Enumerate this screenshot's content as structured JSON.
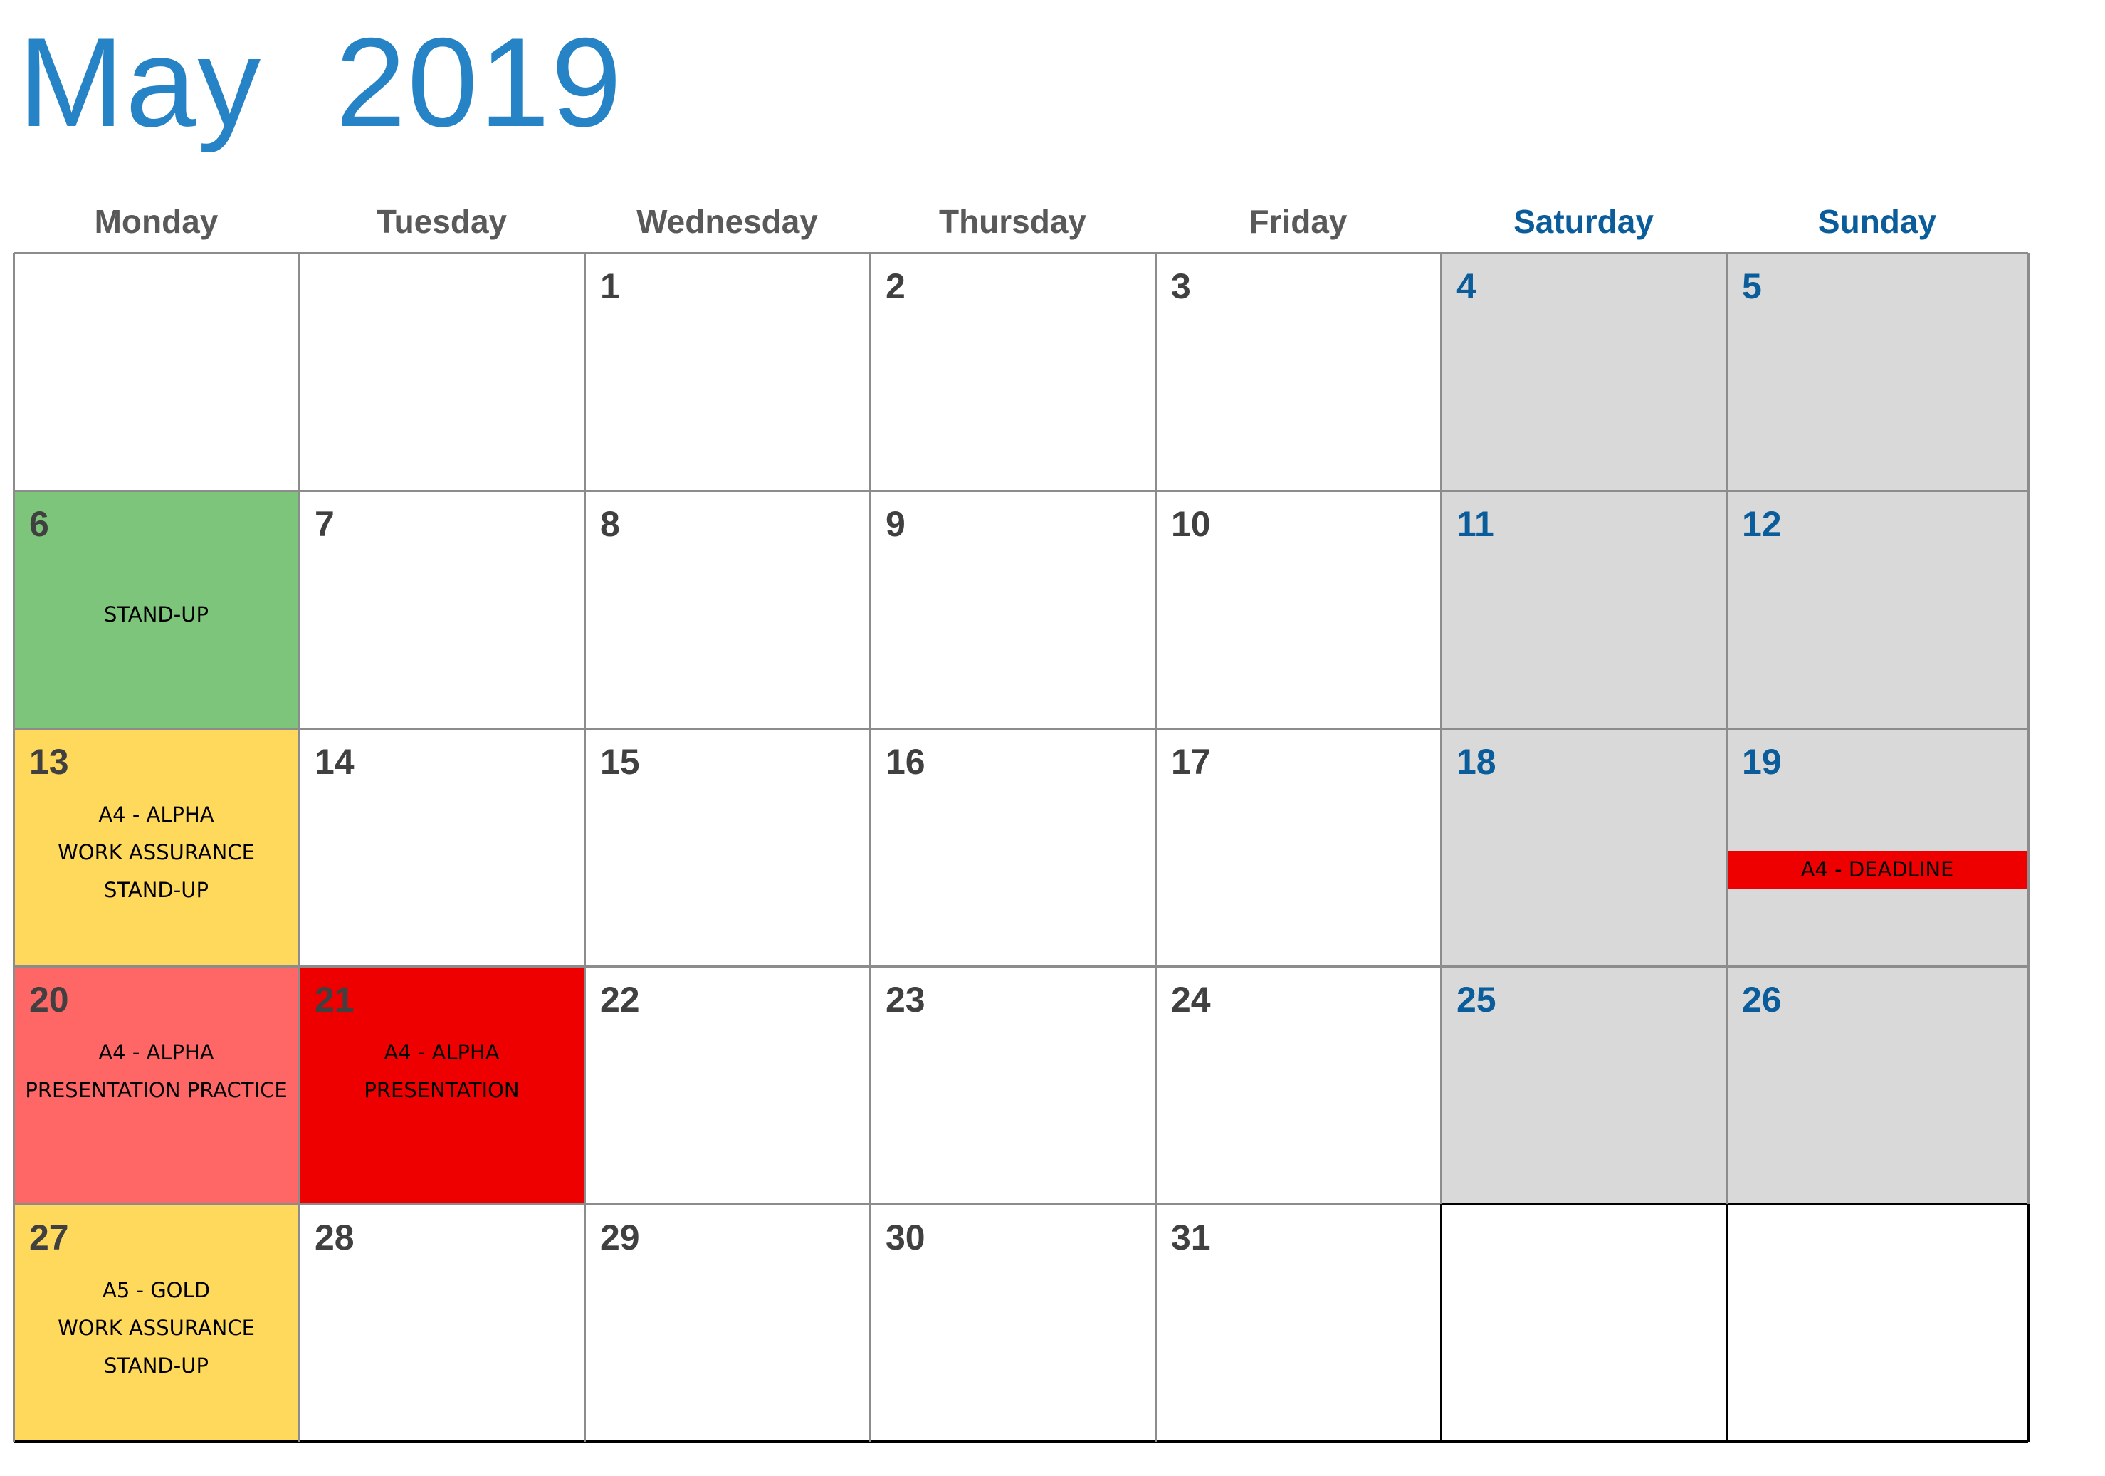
{
  "calendar": {
    "month": "May",
    "year": "2019",
    "weekdays": [
      "Monday",
      "Tuesday",
      "Wednesday",
      "Thursday",
      "Friday",
      "Saturday",
      "Sunday"
    ],
    "colors": {
      "title": "#2683c6",
      "weekday_text": "#595959",
      "weekend_text": "#0a5d9a",
      "weekend_bg": "#d9d9d9",
      "green": "#7dc57a",
      "yellow": "#ffd95c",
      "salmon": "#ff6666",
      "red": "#ee0000",
      "gridline": "#8c8c8c",
      "outline": "#000000"
    },
    "weeks": [
      [
        {
          "day": "",
          "bg": "white",
          "events": []
        },
        {
          "day": "",
          "bg": "white",
          "events": []
        },
        {
          "day": "1",
          "bg": "white",
          "events": []
        },
        {
          "day": "2",
          "bg": "white",
          "events": []
        },
        {
          "day": "3",
          "bg": "white",
          "events": []
        },
        {
          "day": "4",
          "bg": "weekend",
          "events": []
        },
        {
          "day": "5",
          "bg": "weekend",
          "events": []
        }
      ],
      [
        {
          "day": "6",
          "bg": "green",
          "events": [
            "",
            "STAND-UP"
          ]
        },
        {
          "day": "7",
          "bg": "white",
          "events": []
        },
        {
          "day": "8",
          "bg": "white",
          "events": []
        },
        {
          "day": "9",
          "bg": "white",
          "events": []
        },
        {
          "day": "10",
          "bg": "white",
          "events": []
        },
        {
          "day": "11",
          "bg": "weekend",
          "events": []
        },
        {
          "day": "12",
          "bg": "weekend",
          "events": []
        }
      ],
      [
        {
          "day": "13",
          "bg": "yellow",
          "events": [
            "A4 - ALPHA",
            "WORK ASSURANCE",
            "STAND-UP"
          ]
        },
        {
          "day": "14",
          "bg": "white",
          "events": []
        },
        {
          "day": "15",
          "bg": "white",
          "events": []
        },
        {
          "day": "16",
          "bg": "white",
          "events": []
        },
        {
          "day": "17",
          "bg": "white",
          "events": []
        },
        {
          "day": "18",
          "bg": "weekend",
          "events": []
        },
        {
          "day": "19",
          "bg": "weekend",
          "events": [],
          "banner": "A4 - DEADLINE"
        }
      ],
      [
        {
          "day": "20",
          "bg": "salmon",
          "events": [
            "A4 - ALPHA",
            "PRESENTATION PRACTICE"
          ]
        },
        {
          "day": "21",
          "bg": "red",
          "events": [
            "A4 - ALPHA",
            "PRESENTATION"
          ]
        },
        {
          "day": "22",
          "bg": "white",
          "events": []
        },
        {
          "day": "23",
          "bg": "white",
          "events": []
        },
        {
          "day": "24",
          "bg": "white",
          "events": []
        },
        {
          "day": "25",
          "bg": "weekend",
          "events": []
        },
        {
          "day": "26",
          "bg": "weekend",
          "events": []
        }
      ],
      [
        {
          "day": "27",
          "bg": "yellow",
          "events": [
            "A5 - GOLD",
            "WORK ASSURANCE",
            "STAND-UP"
          ]
        },
        {
          "day": "28",
          "bg": "white",
          "events": []
        },
        {
          "day": "29",
          "bg": "white",
          "events": []
        },
        {
          "day": "30",
          "bg": "white",
          "events": []
        },
        {
          "day": "31",
          "bg": "white",
          "events": []
        },
        {
          "day": "",
          "bg": "white",
          "events": []
        },
        {
          "day": "",
          "bg": "white",
          "events": []
        }
      ]
    ]
  }
}
